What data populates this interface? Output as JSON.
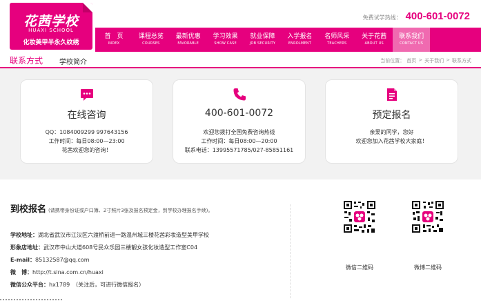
{
  "header": {
    "logo": {
      "cn": "花茜学校",
      "en": "HUAXI SCHOOL",
      "slogan": "化妆美甲半永久纹绣"
    },
    "hotline_label": "免费试学热线：",
    "hotline_number": "400-601-0072"
  },
  "nav": [
    {
      "cn": "首　页",
      "en": "INDEX"
    },
    {
      "cn": "课程总览",
      "en": "COURSES"
    },
    {
      "cn": "最新优惠",
      "en": "FAVORABLE"
    },
    {
      "cn": "学习效果",
      "en": "SHOW CASE"
    },
    {
      "cn": "就业保障",
      "en": "JOB SECURITY"
    },
    {
      "cn": "入学报名",
      "en": "ENROLMENT"
    },
    {
      "cn": "名师风采",
      "en": "TEACHERS"
    },
    {
      "cn": "关于花茜",
      "en": "ABOUT US"
    },
    {
      "cn": "联系我们",
      "en": "CONTACT US"
    }
  ],
  "subnav": {
    "title": "联系方式",
    "link": "学校简介",
    "breadcrumb": [
      "当前位置：",
      "首页",
      ">",
      "关于我们",
      ">",
      "联系方式"
    ]
  },
  "cards": [
    {
      "icon": "chat-icon",
      "title": "在线咨询",
      "lines": [
        "QQ：1084009299 997643156",
        "工作时间：每日08:00—23:00",
        "花茜欢迎您的咨询！"
      ]
    },
    {
      "icon": "phone-icon",
      "title": "400-601-0072",
      "lines": [
        "欢迎您拨打全国免费咨询热线",
        "工作时间：每日08:00—20:00",
        "联系电话：13995571785/027-85851161"
      ]
    },
    {
      "icon": "document-icon",
      "title": "预定报名",
      "lines": [
        "亲爱的同学，您好",
        "欢迎您加入花茜学校大家庭！"
      ]
    }
  ],
  "visit": {
    "title": "到校报名",
    "note": "(请携带身份证或户口簿、2寸照片3张及报名预定金，到学校办理报名手续)。",
    "rows": [
      {
        "k": "学校地址",
        "sep": "：",
        "v": "湖北省武汉市江汉区六渡桥前进一路温州城三楼花茜彩妆造型美甲学校"
      },
      {
        "k": "形象店地址",
        "sep": "：",
        "v": "武汉市中山大道608号民众乐园三楼靓女孩化妆造型工作室C04"
      },
      {
        "k": "E-mail",
        "sep": "：",
        "v": "85132587@qq.com"
      },
      {
        "k": "微　博",
        "sep": "：",
        "v": "http://t.sina.com.cn/huaxi"
      },
      {
        "k": "微信公众平台",
        "sep": "：",
        "v": "hx1789　（关注后，可进行微信报名）"
      }
    ],
    "qr": [
      {
        "label": "微信二维码"
      },
      {
        "label": "微博二维码"
      }
    ]
  },
  "colors": {
    "brand": "#e6007e",
    "brand_light": "#f06ab0",
    "panel_bg": "#f2f2f2"
  }
}
